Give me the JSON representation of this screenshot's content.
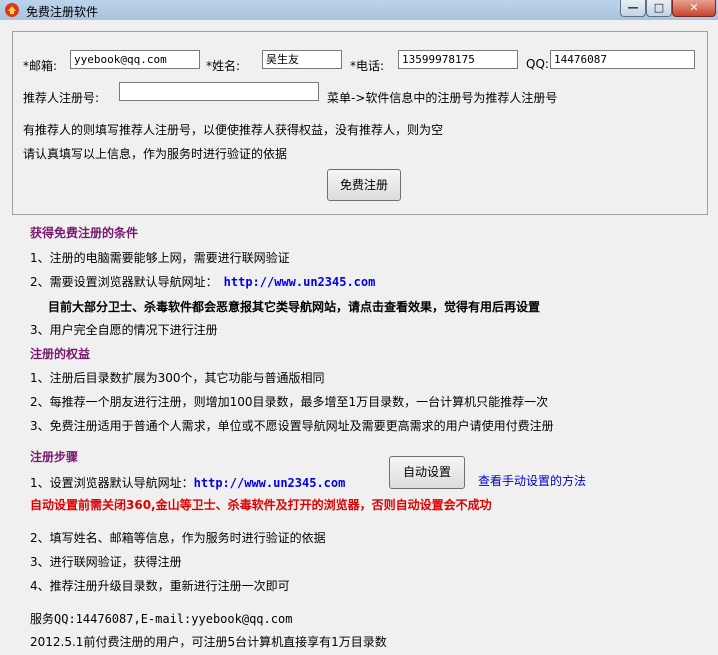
{
  "window": {
    "title": "免费注册软件",
    "minimize_glyph": "—",
    "maximize_glyph": "□",
    "close_glyph": "✕"
  },
  "form": {
    "email_label": "*邮箱:",
    "email_value": "yyebook@qq.com",
    "name_label": "*姓名:",
    "name_value": "吴生友",
    "phone_label": "*电话:",
    "phone_value": "13599978175",
    "qq_label": "QQ:",
    "qq_value": "14476087",
    "referrer_label": "推荐人注册号:",
    "referrer_value": "",
    "referrer_hint": "菜单->软件信息中的注册号为推荐人注册号",
    "note_1": "有推荐人的则填写推荐人注册号，以便使推荐人获得权益，没有推荐人，则为空",
    "note_2": "请认真填写以上信息，作为服务时进行验证的依据",
    "register_button": "免费注册"
  },
  "conditions": {
    "heading": "获得免费注册的条件",
    "item_1": "1、注册的电脑需要能够上网，需要进行联网验证",
    "item_2_prefix": "2、需要设置浏览器默认导航网址：",
    "url": "http://www.un2345.com",
    "warning": "目前大部分卫士、杀毒软件都会恶意报其它类导航网站，请点击查看效果，觉得有用后再设置",
    "item_3": "3、用户完全自愿的情况下进行注册"
  },
  "benefits": {
    "heading": "注册的权益",
    "item_1": "1、注册后目录数扩展为300个，其它功能与普通版相同",
    "item_2": "2、每推荐一个朋友进行注册，则增加100目录数，最多增至1万目录数，一台计算机只能推荐一次",
    "item_3": "3、免费注册适用于普通个人需求，单位或不愿设置导航网址及需要更高需求的用户请使用付费注册"
  },
  "steps": {
    "heading": "注册步骤",
    "item_1_prefix": "1、设置浏览器默认导航网址：",
    "url": "http://www.un2345.com",
    "auto_set_button": "自动设置",
    "manual_link": "查看手动设置的方法",
    "red_warning": "自动设置前需关闭360,金山等卫士、杀毒软件及打开的浏览器，否则自动设置会不成功",
    "item_2": "2、填写姓名、邮箱等信息，作为服务时进行验证的依据",
    "item_3": "3、进行联网验证，获得注册",
    "item_4": "4、推荐注册升级目录数，重新进行注册一次即可"
  },
  "footer": {
    "service": "服务QQ:14476087,E-mail:yyebook@qq.com",
    "notice": "2012.5.1前付费注册的用户，可注册5台计算机直接享有1万目录数"
  },
  "colors": {
    "heading": "#7a1a6e",
    "url": "#0000ee",
    "warning_red": "#e00000",
    "link": "#0000cc"
  }
}
